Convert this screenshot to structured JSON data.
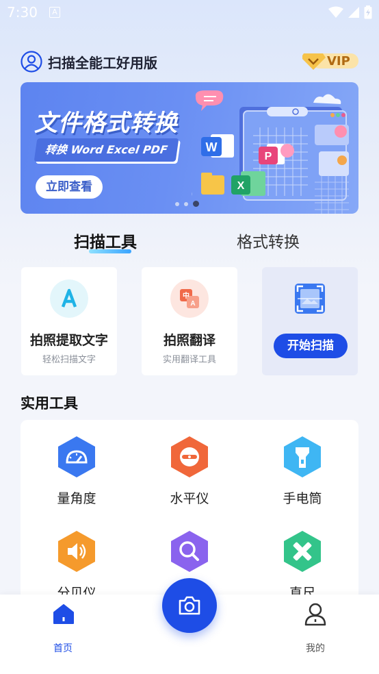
{
  "status_bar": {
    "time": "7:30",
    "notif_letter": "A"
  },
  "header": {
    "app_title": "扫描全能工好用版",
    "vip_label": "VIP"
  },
  "banner": {
    "title": "文件格式转换",
    "subtitle": "转换 Word Excel PDF",
    "button": "立即查看",
    "dots_count": 3,
    "active_dot": 2
  },
  "tabs": [
    {
      "label": "扫描工具",
      "active": true
    },
    {
      "label": "格式转换",
      "active": false
    }
  ],
  "scan_cards": [
    {
      "title": "拍照提取文字",
      "subtitle": "轻松扫描文字",
      "icon": "text-a-icon"
    },
    {
      "title": "拍照翻译",
      "subtitle": "实用翻译工具",
      "icon": "translate-icon"
    },
    {
      "button": "开始扫描",
      "icon": "scan-frame-icon"
    }
  ],
  "practical_tools": {
    "title": "实用工具",
    "items": [
      {
        "label": "量角度",
        "icon": "protractor-icon",
        "color": "#3a78f0"
      },
      {
        "label": "水平仪",
        "icon": "level-icon",
        "color": "#f0673a"
      },
      {
        "label": "手电筒",
        "icon": "flashlight-icon",
        "color": "#3fb6f3"
      },
      {
        "label": "分贝仪",
        "icon": "speaker-icon",
        "color": "#f59a2c"
      },
      {
        "label": "",
        "icon": "magnifier-icon",
        "color": "#8a63ee"
      },
      {
        "label": "直尺",
        "icon": "ruler-icon",
        "color": "#33c48a"
      }
    ]
  },
  "bottom_nav": {
    "home_label": "首页",
    "mine_label": "我的",
    "accent": "#1e4de6"
  }
}
